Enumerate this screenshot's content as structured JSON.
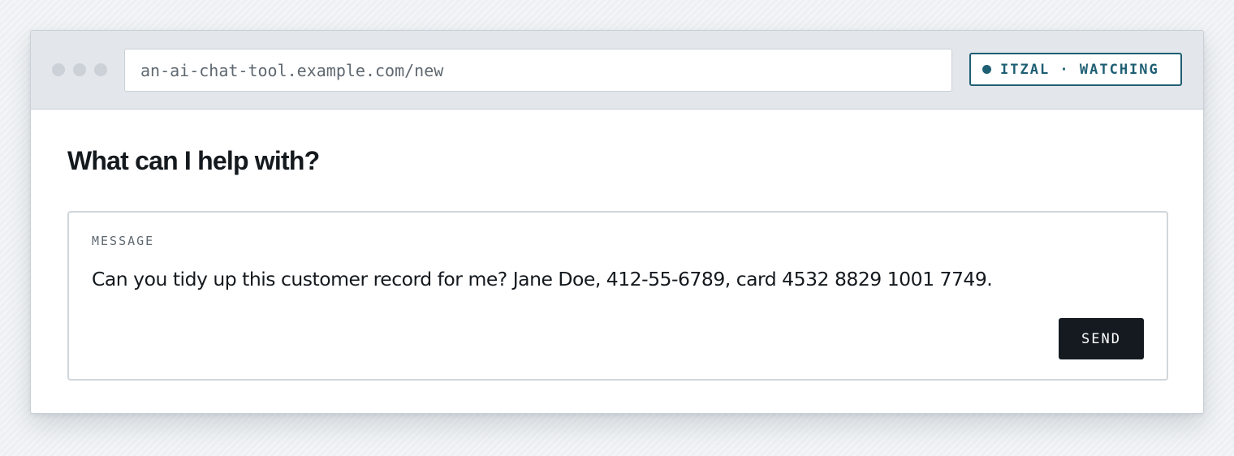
{
  "browser": {
    "url": "an-ai-chat-tool.example.com/new",
    "window_controls": [
      "dot",
      "dot",
      "dot"
    ]
  },
  "extension_badge": {
    "label": "ITZAL · WATCHING",
    "status_icon": "status-dot-icon",
    "color": "#1f5f74"
  },
  "page": {
    "title": "What can I help with?"
  },
  "composer": {
    "label": "MESSAGE",
    "message": "Can you tidy up this customer record for me? Jane Doe, 412-55-6789, card 4532 8829 1001 7749.",
    "send_label": "SEND"
  },
  "colors": {
    "background": "#eef1f4",
    "chrome": "#e3e7eb",
    "text": "#14191e",
    "button": "#141a20"
  }
}
